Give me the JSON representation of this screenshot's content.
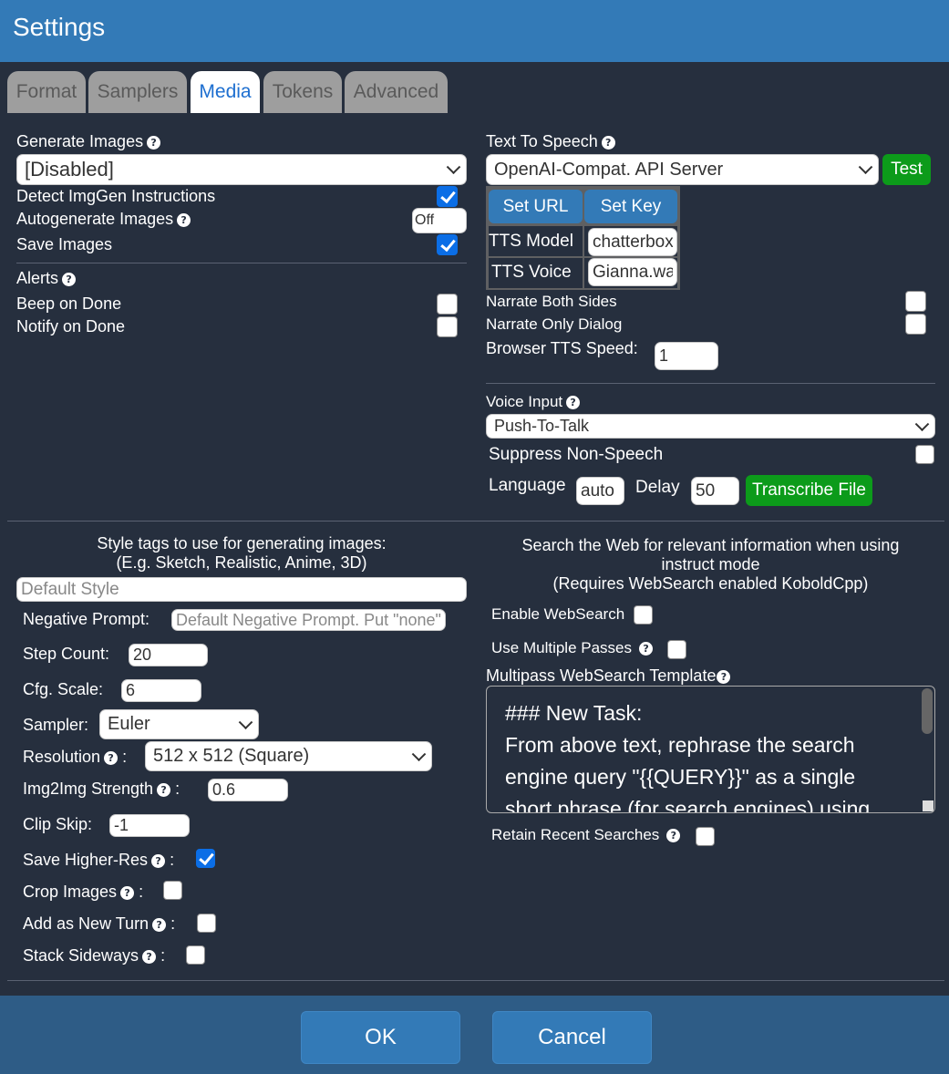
{
  "window": {
    "title": "Settings"
  },
  "tabs": [
    {
      "label": "Format"
    },
    {
      "label": "Samplers"
    },
    {
      "label": "Media"
    },
    {
      "label": "Tokens"
    },
    {
      "label": "Advanced"
    }
  ],
  "image_gen": {
    "label": "Generate Images",
    "selected": "[Disabled]",
    "detect_label": "Detect ImgGen Instructions",
    "detect_checked": true,
    "autogen_label": "Autogenerate Images",
    "autogen_value": "Off",
    "save_label": "Save Images",
    "save_checked": true
  },
  "alerts": {
    "label": "Alerts",
    "beep_label": "Beep on Done",
    "beep_checked": false,
    "notify_label": "Notify on Done",
    "notify_checked": false
  },
  "tts": {
    "label": "Text To Speech",
    "selected": "OpenAI-Compat. API Server",
    "test_label": "Test",
    "set_url_label": "Set URL",
    "set_key_label": "Set Key",
    "model_label": "TTS Model",
    "model_value": "chatterbox",
    "voice_label": "TTS Voice",
    "voice_value": "Gianna.wav",
    "narrate_both_label": "Narrate Both Sides",
    "narrate_both_checked": false,
    "narrate_dialog_label": "Narrate Only Dialog",
    "narrate_dialog_checked": false,
    "browser_speed_label": "Browser TTS Speed:",
    "browser_speed_value": "1"
  },
  "voice_input": {
    "label": "Voice Input",
    "selected": "Push-To-Talk",
    "suppress_label": "Suppress Non-Speech",
    "suppress_checked": false,
    "language_label": "Language",
    "language_value": "auto",
    "delay_label": "Delay",
    "delay_value": "50",
    "transcribe_label": "Transcribe File"
  },
  "style": {
    "heading_line1": "Style tags to use for generating images:",
    "heading_line2": "(E.g. Sketch, Realistic, Anime, 3D)",
    "style_placeholder": "Default Style",
    "negative_label": "Negative Prompt:",
    "negative_placeholder": "Default Negative Prompt. Put \"none\" to skip",
    "step_label": "Step Count:",
    "step_value": "20",
    "cfg_label": "Cfg. Scale:",
    "cfg_value": "6",
    "sampler_label": "Sampler:",
    "sampler_selected": "Euler",
    "resolution_label": "Resolution",
    "resolution_selected": "512 x 512 (Square)",
    "img2img_label": "Img2Img Strength",
    "img2img_value": "0.6",
    "clip_label": "Clip Skip:",
    "clip_value": "-1",
    "higher_res_label": "Save Higher-Res",
    "higher_res_checked": true,
    "crop_label": "Crop Images",
    "crop_checked": false,
    "new_turn_label": "Add as New Turn",
    "new_turn_checked": false,
    "sideways_label": "Stack Sideways",
    "sideways_checked": false,
    "colon": ":"
  },
  "websearch": {
    "heading_line1": "Search the Web for relevant information when using",
    "heading_line2": "instruct mode",
    "heading_line3": "(Requires WebSearch enabled KoboldCpp)",
    "enable_label": "Enable WebSearch",
    "enable_checked": false,
    "multipass_label": "Use Multiple Passes",
    "multipass_checked": false,
    "template_label": "Multipass WebSearch Template",
    "template_text": "### New Task:\nFrom above text, rephrase the search engine query \"{{QUERY}}\" as a single short phrase (for search engines) using",
    "retain_label": "Retain Recent Searches",
    "retain_checked": false
  },
  "footer": {
    "ok_label": "OK",
    "cancel_label": "Cancel"
  },
  "icons": {
    "help": "help-icon",
    "dropdown": "chevron-down-icon",
    "check": "check-icon"
  },
  "colors": {
    "titlebar": "#337ab7",
    "background": "#262f3e",
    "accent_green": "#0c9b1a",
    "footer": "#2e5c86"
  }
}
